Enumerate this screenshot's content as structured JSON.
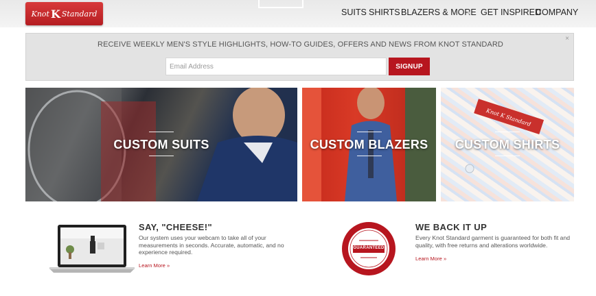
{
  "header": {
    "logo_left": "Knot",
    "logo_mark": "K",
    "logo_right": "Standard",
    "nav": [
      "SUITS",
      "SHIRTS",
      "BLAZERS & MORE",
      "GET INSPIRED",
      "COMPANY"
    ]
  },
  "signup": {
    "message": "RECEIVE WEEKLY MEN'S STYLE HIGHLIGHTS, HOW-TO GUIDES, OFFERS AND NEWS FROM KNOT STANDARD",
    "email_placeholder": "Email Address",
    "button_label": "SIGNUP",
    "close_glyph": "×"
  },
  "categories": [
    {
      "label": "CUSTOM SUITS"
    },
    {
      "label": "CUSTOM BLAZERS"
    },
    {
      "label": "CUSTOM SHIRTS"
    }
  ],
  "features": [
    {
      "title": "SAY, \"CHEESE!\"",
      "text": "Our system uses your webcam to take all of your measurements in seconds. Accurate, automatic, and no experience required.",
      "link": "Learn More »",
      "icon": "laptop-icon"
    },
    {
      "title": "WE BACK IT UP",
      "text": "Every Knot Standard garment is guaranteed for both fit and quality, with free returns and alterations worldwide.",
      "link": "Learn More »",
      "icon": "guarantee-seal-icon",
      "seal_text": "GUARANTEED"
    }
  ],
  "colors": {
    "brand_red": "#b7161f",
    "banner_bg": "#e3e3e3",
    "header_bg": "#eeeeee"
  }
}
